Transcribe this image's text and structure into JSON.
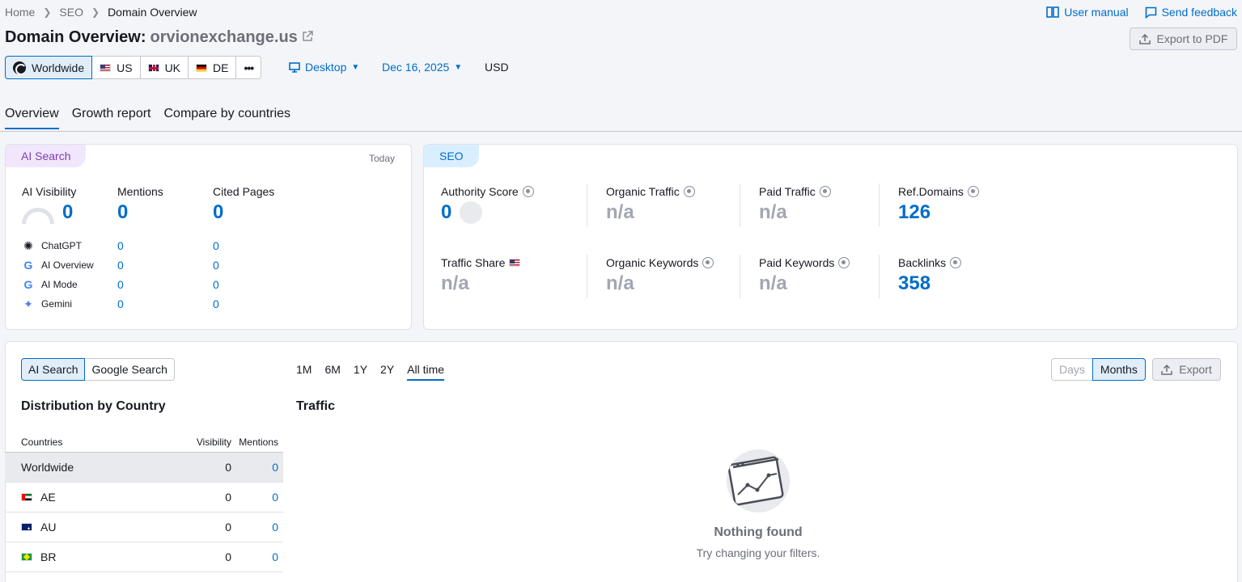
{
  "breadcrumb": {
    "home": "Home",
    "seo": "SEO",
    "current": "Domain Overview"
  },
  "top_links": {
    "user_manual": "User manual",
    "send_feedback": "Send feedback"
  },
  "title": {
    "prefix": "Domain Overview:",
    "domain": "orvionexchange.us"
  },
  "export_pdf": "Export to PDF",
  "databases": [
    {
      "label": "Worldwide",
      "active": true
    },
    {
      "label": "US"
    },
    {
      "label": "UK"
    },
    {
      "label": "DE"
    }
  ],
  "more_label": "•••",
  "device": "Desktop",
  "date": "Dec 16, 2025",
  "currency": "USD",
  "tabs": [
    "Overview",
    "Growth report",
    "Compare by countries"
  ],
  "ai_card": {
    "tag": "AI Search",
    "today": "Today",
    "metrics": [
      {
        "label": "AI Visibility",
        "value": "0"
      },
      {
        "label": "Mentions",
        "value": "0"
      },
      {
        "label": "Cited Pages",
        "value": "0"
      }
    ],
    "rows": [
      {
        "name": "ChatGPT",
        "v1": "0",
        "v2": "0"
      },
      {
        "name": "AI Overview",
        "v1": "0",
        "v2": "0"
      },
      {
        "name": "AI Mode",
        "v1": "0",
        "v2": "0"
      },
      {
        "name": "Gemini",
        "v1": "0",
        "v2": "0"
      }
    ]
  },
  "seo_card": {
    "tag": "SEO",
    "authority_score": {
      "label": "Authority Score",
      "value": "0"
    },
    "organic_traffic": {
      "label": "Organic Traffic",
      "value": "n/a"
    },
    "paid_traffic": {
      "label": "Paid Traffic",
      "value": "n/a"
    },
    "ref_domains": {
      "label": "Ref.Domains",
      "value": "126"
    },
    "traffic_share": {
      "label": "Traffic Share",
      "value": "n/a"
    },
    "organic_keywords": {
      "label": "Organic Keywords",
      "value": "n/a"
    },
    "paid_keywords": {
      "label": "Paid Keywords",
      "value": "n/a"
    },
    "backlinks": {
      "label": "Backlinks",
      "value": "358"
    }
  },
  "bottom": {
    "search_toggle": [
      "AI Search",
      "Google Search"
    ],
    "periods": [
      "1M",
      "6M",
      "1Y",
      "2Y",
      "All time"
    ],
    "days": "Days",
    "months": "Months",
    "export": "Export",
    "dist_title": "Distribution by Country",
    "traffic_title": "Traffic",
    "table": {
      "headers": [
        "Countries",
        "Visibility",
        "Mentions"
      ],
      "rows": [
        {
          "country": "Worldwide",
          "visibility": "0",
          "mentions": "0"
        },
        {
          "country": "AE",
          "visibility": "0",
          "mentions": "0"
        },
        {
          "country": "AU",
          "visibility": "0",
          "mentions": "0"
        },
        {
          "country": "BR",
          "visibility": "0",
          "mentions": "0"
        }
      ]
    },
    "empty": {
      "title": "Nothing found",
      "subtitle": "Try changing your filters."
    }
  },
  "colors": {
    "accent": "#006dca",
    "ai_tag": "#7b3fb6",
    "muted": "#a3a6b3"
  }
}
